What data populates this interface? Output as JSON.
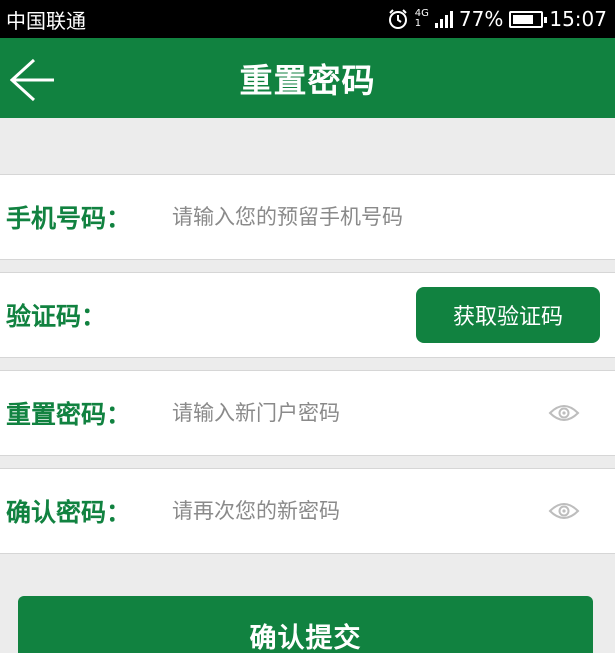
{
  "status_bar": {
    "carrier": "中国联通",
    "network": "4G",
    "network_sub": "1",
    "battery": "77%",
    "time": "15:07"
  },
  "app_bar": {
    "back_icon": "arrow-left-icon",
    "title": "重置密码"
  },
  "form": {
    "phone": {
      "label": "手机号码：",
      "placeholder": "请输入您的预留手机号码"
    },
    "code": {
      "label": "验证码：",
      "button": "获取验证码"
    },
    "new_password": {
      "label": "重置密码：",
      "placeholder": "请输入新门户密码",
      "icon": "eye-icon"
    },
    "confirm_password": {
      "label": "确认密码：",
      "placeholder": "请再次您的新密码",
      "icon": "eye-icon"
    }
  },
  "submit_label": "确认提交",
  "colors": {
    "primary": "#118240",
    "background": "#ececec",
    "status_bar": "#000000"
  }
}
